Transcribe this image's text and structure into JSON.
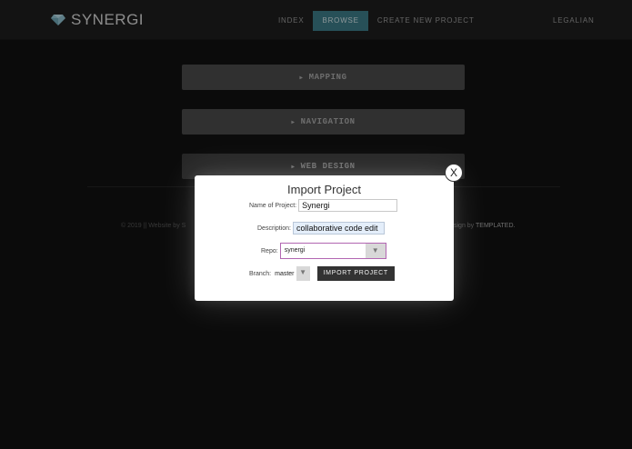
{
  "header": {
    "logo_text": "SYNERGI",
    "nav": [
      {
        "label": "INDEX"
      },
      {
        "label": "BROWSE"
      },
      {
        "label": "CREATE NEW PROJECT"
      }
    ],
    "user_label": "LEGALIAN"
  },
  "sections": [
    {
      "label": "MAPPING"
    },
    {
      "label": "NAVIGATION"
    },
    {
      "label": "WEB DESIGN"
    }
  ],
  "footer": {
    "left": "© 2019 || Website by S",
    "right_prefix": "sign by",
    "right_brand": "TEMPLATED."
  },
  "modal": {
    "title": "Import Project",
    "close_label": "X",
    "name_label": "Name of Project:",
    "name_value": "Synergi",
    "description_label": "Description:",
    "description_value": "collaborative code edit",
    "repo_label": "Repo:",
    "repo_value": "synergi",
    "branch_label": "Branch:",
    "branch_value": "master",
    "import_label": "IMPORT PROJECT",
    "dropdown_arrow": "▼"
  },
  "colors": {
    "accent": "#3d7c88",
    "repo_border": "#b266b2"
  }
}
